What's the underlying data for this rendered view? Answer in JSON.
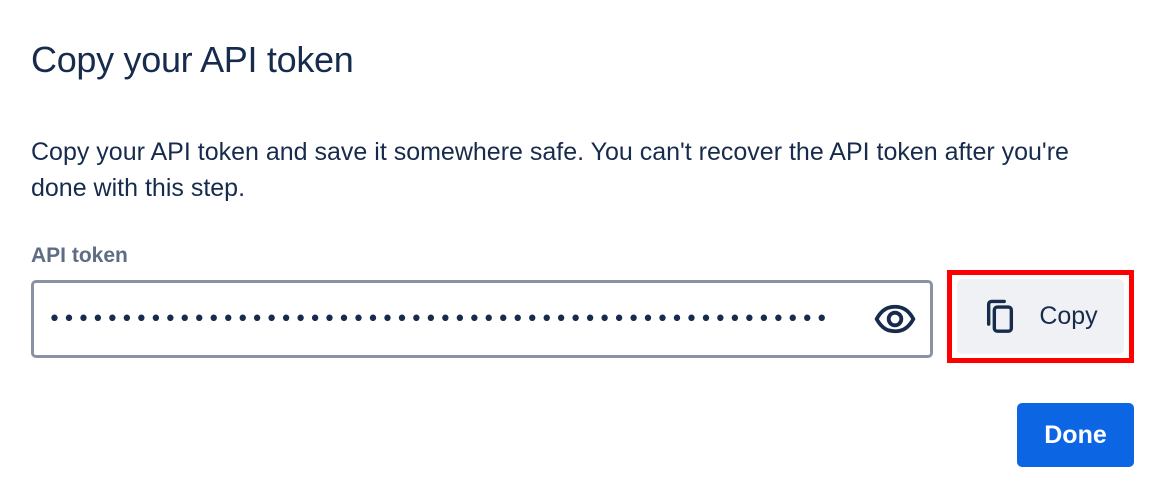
{
  "dialog": {
    "title": "Copy your API token",
    "description": "Copy your API token and save it somewhere safe. You can't recover the API token after you're done with this step."
  },
  "token_field": {
    "label": "API token",
    "masked_value": "••••••••••••••••••••••••••••••••••••••••••••••••••••••",
    "reveal_icon": "eye-icon"
  },
  "actions": {
    "copy_label": "Copy",
    "copy_icon": "copy-icon",
    "done_label": "Done"
  },
  "colors": {
    "text": "#172b4d",
    "label": "#5e6c84",
    "primary": "#0c66e4",
    "highlight": "#ff0000",
    "secondary_bg": "#f0f1f4"
  }
}
